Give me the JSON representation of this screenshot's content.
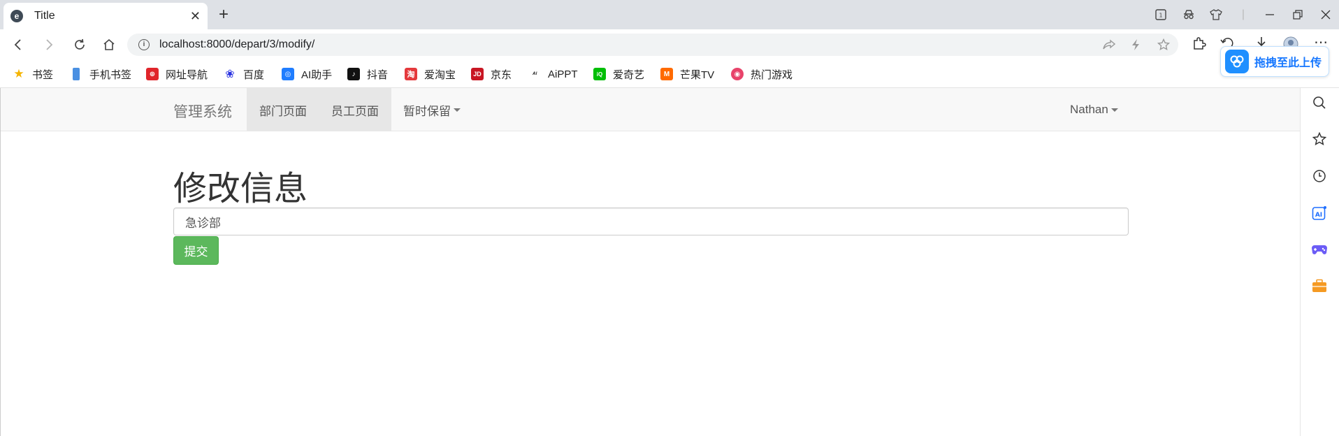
{
  "browser": {
    "tab_title": "Title",
    "tab_close": "✕",
    "new_tab": "+",
    "url": "localhost:8000/depart/3/modify/"
  },
  "bookmarks": [
    {
      "label": "书签",
      "icon": "star-icon",
      "color": "#f5b400",
      "glyph": "★"
    },
    {
      "label": "手机书签",
      "icon": "phone-icon",
      "color": "#4a90e2",
      "glyph": ""
    },
    {
      "label": "网址导航",
      "icon": "hao123-icon",
      "color": "#e0252b",
      "glyph": "⊕"
    },
    {
      "label": "百度",
      "icon": "baidu-icon",
      "color": "#2932e1",
      "glyph": "❀"
    },
    {
      "label": "AI助手",
      "icon": "ai-assistant-icon",
      "color": "#1f7dff",
      "glyph": "◎"
    },
    {
      "label": "抖音",
      "icon": "douyin-icon",
      "color": "#111111",
      "glyph": "♪"
    },
    {
      "label": "爱淘宝",
      "icon": "taobao-icon",
      "color": "#e4393c",
      "glyph": "淘"
    },
    {
      "label": "京东",
      "icon": "jd-icon",
      "color": "#c81623",
      "glyph": "JD"
    },
    {
      "label": "AiPPT",
      "icon": "aippt-icon",
      "color": "#ffffff",
      "glyph": "ᴬᴵ"
    },
    {
      "label": "爱奇艺",
      "icon": "iqiyi-icon",
      "color": "#00be06",
      "glyph": "iQ"
    },
    {
      "label": "芒果TV",
      "icon": "mangotv-icon",
      "color": "#ff6a00",
      "glyph": "M"
    },
    {
      "label": "热门游戏",
      "icon": "game-icon",
      "color": "#e8436a",
      "glyph": "◉"
    }
  ],
  "upload_button": {
    "label": "拖拽至此上传",
    "icon": "baidu-netdisk-icon"
  },
  "app": {
    "brand": "管理系统",
    "nav": [
      {
        "label": "部门页面"
      },
      {
        "label": "员工页面"
      },
      {
        "label": "暂时保留"
      }
    ],
    "user": "Nathan"
  },
  "form": {
    "heading": "修改信息",
    "value": "急诊部",
    "submit_label": "提交"
  }
}
